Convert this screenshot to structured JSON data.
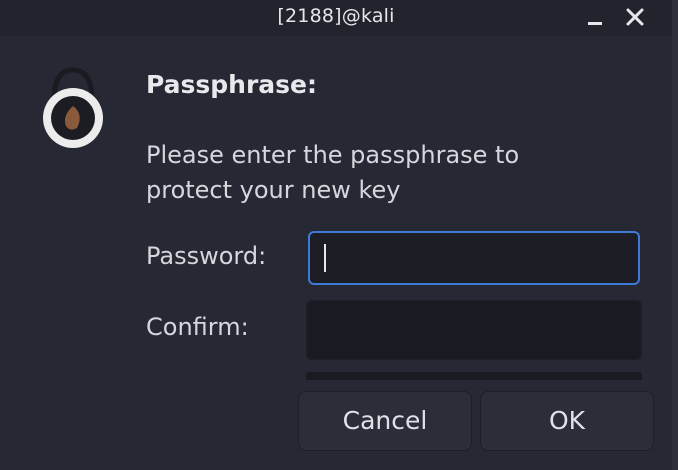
{
  "window": {
    "title": "[2188]@kali",
    "controls": {
      "minimize_icon": "minimize-icon",
      "close_icon": "close-icon"
    }
  },
  "dialog": {
    "icon": "lock-icon",
    "heading": "Passphrase:",
    "description": "Please enter the passphrase to protect your new key",
    "fields": {
      "password": {
        "label": "Password:",
        "value": ""
      },
      "confirm": {
        "label": "Confirm:",
        "value": ""
      }
    },
    "buttons": {
      "cancel": "Cancel",
      "ok": "OK"
    }
  },
  "colors": {
    "background": "#262833",
    "titlebar": "#22232d",
    "input_background": "#1a1b22",
    "focus_border": "#3d7bd6",
    "text": "#d6d7dc",
    "icon_brown": "#8a5a3c"
  }
}
